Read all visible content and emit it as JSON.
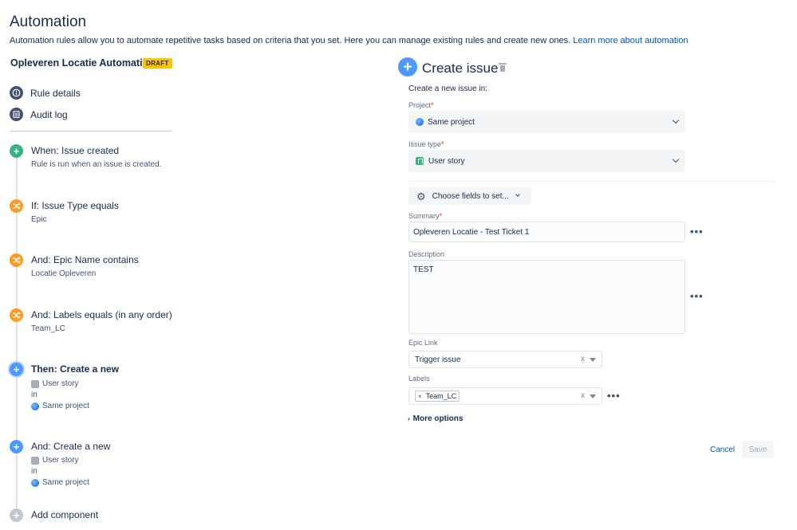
{
  "page": {
    "title": "Automation",
    "intro": "Automation rules allow you to automate repetitive tasks based on criteria that you set. Here you can manage existing rules and create new ones.",
    "learn_more": "Learn more about automation"
  },
  "rule": {
    "name": "Opleveren Locatie Automation",
    "badge": "DRAFT"
  },
  "nav": {
    "rule_details": "Rule details",
    "audit_log": "Audit log"
  },
  "components": [
    {
      "title": "When: Issue created",
      "sub": "Rule is run when an issue is created.",
      "icon": "plus-icon",
      "color": "#36b37e"
    },
    {
      "title": "If: Issue Type equals",
      "sub": "Epic",
      "icon": "shuffle-icon",
      "color": "#ff991f"
    },
    {
      "title": "And: Epic Name contains",
      "sub": "Locatie Opleveren",
      "icon": "shuffle-icon",
      "color": "#ff991f"
    },
    {
      "title": "And: Labels equals (in any order)",
      "sub": "Team_LC",
      "icon": "shuffle-icon",
      "color": "#ff991f"
    },
    {
      "title": "Then: Create a new",
      "issue_type": "User story",
      "in": "in",
      "project": "Same project",
      "icon": "plus-icon",
      "color": "#4c9aff"
    },
    {
      "title": "And: Create a new",
      "issue_type": "User story",
      "in": "in",
      "project": "Same project",
      "icon": "plus-icon",
      "color": "#4c9aff"
    }
  ],
  "add_component": "Add component",
  "panel": {
    "title": "Create issue",
    "create_in": "Create a new issue in:",
    "project_label": "Project",
    "project_value": "Same project",
    "issue_type_label": "Issue type",
    "issue_type_value": "User story",
    "required_mark": "*",
    "choose_fields": "Choose fields to set...",
    "summary_label": "Summary",
    "summary_value": "Opleveren Locatie - Test Ticket 1",
    "description_label": "Description",
    "description_value": "TEST",
    "epic_link_label": "Epic Link",
    "epic_link_value": "Trigger issue",
    "labels_label": "Labels",
    "labels_value": "Team_LC",
    "more_options": "More options",
    "cancel": "Cancel",
    "save": "Save",
    "dots": "•••",
    "clear": "x",
    "tag_remove": "×",
    "arrow": "›"
  },
  "colors": {
    "accent": "#0052cc",
    "draft": "#ffc400",
    "trigger": "#36b37e",
    "condition": "#ff991f",
    "action": "#4c9aff"
  }
}
